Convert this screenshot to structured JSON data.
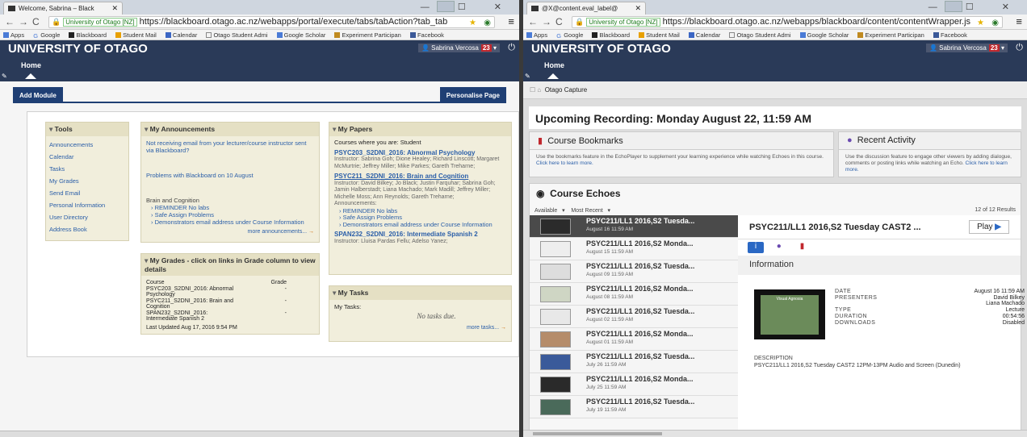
{
  "left": {
    "tab_title": "Welcome, Sabrina – Black",
    "window_controls": "— ☐ ✕",
    "url": {
      "site": "University of Otago [NZ]",
      "text": "https://blackboard.otago.ac.nz/webapps/portal/execute/tabs/tabAction?tab_tab"
    },
    "bookmarks": [
      "Apps",
      "Google",
      "Blackboard",
      "Student Mail",
      "Calendar",
      "Otago Student Admi",
      "Google Scholar",
      "Experiment Participan",
      "Facebook"
    ],
    "brand": "UNIVERSITY OF OTAGO",
    "user": "Sabrina Vercosa",
    "badge": "23",
    "home_tab": "Home",
    "add_module": "Add Module",
    "personalise": "Personalise Page",
    "tools": {
      "title": "Tools",
      "items": [
        "Announcements",
        "Calendar",
        "Tasks",
        "My Grades",
        "Send Email",
        "Personal Information",
        "User Directory",
        "Address Book"
      ]
    },
    "announcements": {
      "title": "My Announcements",
      "a1": "Not receiving email from your lecturer/course instructor sent via Blackboard?",
      "a2": "Problems with Blackboard on 10 August",
      "group": "Brain and Cognition",
      "bullets": [
        "REMINDER No labs",
        "Safe Assign Problems",
        "Demonstrators email address under Course Information"
      ],
      "more": "more announcements..."
    },
    "grades": {
      "title": "My Grades - click on links in Grade column to view details",
      "col_course": "Course",
      "col_grade": "Grade",
      "rows": [
        {
          "course": "PSYC203_S2DNI_2016: Abnormal Psychology",
          "grade": "-"
        },
        {
          "course": "PSYC211_S2DNI_2016: Brain and Cognition",
          "grade": "-"
        },
        {
          "course": "SPAN232_S2DNI_2016: Intermediate Spanish 2",
          "grade": "-"
        }
      ],
      "updated": "Last Updated Aug 17, 2016 9:54 PM"
    },
    "papers": {
      "title": "My Papers",
      "intro": "Courses where you are: Student",
      "p1": "PSYC203_S2DNI_2016: Abnormal Psychology",
      "p1_instr": "Instructor: Sabrina Goh; Dione Healey; Richard Linscott; Margaret McMurtrie; Jeffrey Miller; Mike Parkes; Gareth Treharne;",
      "p2": "PSYC211_S2DNI_2016: Brain and Cognition",
      "p2_instr": "Instructor: David Bilkey; Jo Black; Justin Farquhar; Sabrina Goh; Jamin Halberstadt; Liana Machado; Mark Madill; Jeffrey Miller; Michelle Moss; Ann Reynolds; Gareth Treharne;",
      "ann_label": "Announcements:",
      "ann": [
        "REMINDER No labs",
        "Safe Assign Problems",
        "Demonstrators email address under Course Information"
      ],
      "p3": "SPAN232_S2DNI_2016: Intermediate Spanish 2",
      "p3_instr": "Instructor: Lluisa Pardas Fellu; Adelso Yanez;"
    },
    "tasks": {
      "title": "My Tasks",
      "label": "My Tasks:",
      "empty": "No tasks due.",
      "more": "more tasks..."
    }
  },
  "right": {
    "tab_title": "@X@content.eval_label@",
    "window_controls": "— ☐ ✕",
    "url": {
      "site": "University of Otago [NZ]",
      "text": "https://blackboard.otago.ac.nz/webapps/blackboard/content/contentWrapper.js"
    },
    "bookmarks": [
      "Apps",
      "Google",
      "Blackboard",
      "Student Mail",
      "Calendar",
      "Otago Student Admi",
      "Google Scholar",
      "Experiment Participan",
      "Facebook"
    ],
    "brand": "UNIVERSITY OF OTAGO",
    "user": "Sabrina Vercosa",
    "badge": "23",
    "home_tab": "Home",
    "crumb": "Otago Capture",
    "upcoming": "Upcoming Recording: Monday August 22, 11:59 AM",
    "bookmarks_card": {
      "title": "Course Bookmarks",
      "text": "Use the bookmarks feature in the EchoPlayer to supplement your learning experience while watching Echoes in this course.",
      "link": "Click here to learn more."
    },
    "activity_card": {
      "title": "Recent Activity",
      "text": "Use the discussion feature to engage other viewers by adding dialogue, comments or posting links while watching an Echo.",
      "link": "Click here to learn more."
    },
    "echoes": {
      "title": "Course Echoes",
      "filter1": "Available",
      "filter2": "Most Recent",
      "results": "12 of 12 Results",
      "items": [
        {
          "title": "PSYC211/LL1 2016,S2 Tuesda...",
          "date": "August 16 11:59 AM"
        },
        {
          "title": "PSYC211/LL1 2016,S2 Monda...",
          "date": "August 15 11:59 AM"
        },
        {
          "title": "PSYC211/LL1 2016,S2 Tuesda...",
          "date": "August 09 11:59 AM"
        },
        {
          "title": "PSYC211/LL1 2016,S2 Monda...",
          "date": "August 08 11:59 AM"
        },
        {
          "title": "PSYC211/LL1 2016,S2 Tuesda...",
          "date": "August 02 11:59 AM"
        },
        {
          "title": "PSYC211/LL1 2016,S2 Monda...",
          "date": "August 01 11:59 AM"
        },
        {
          "title": "PSYC211/LL1 2016,S2 Tuesda...",
          "date": "July 26 11:59 AM"
        },
        {
          "title": "PSYC211/LL1 2016,S2 Monda...",
          "date": "July 25 11:59 AM"
        },
        {
          "title": "PSYC211/LL1 2016,S2 Tuesda...",
          "date": "July 19 11:59 AM"
        }
      ]
    },
    "detail": {
      "title": "PSYC211/LL1 2016,S2 Tuesday CAST2 ...",
      "play": "Play",
      "info": "Information",
      "video_caption": "Visual Agnosia",
      "date_label": "DATE",
      "date": "August 16 11:59 AM",
      "presenters_label": "PRESENTERS",
      "presenters": [
        "David Bilkey",
        "Liana Machado"
      ],
      "type_label": "TYPE",
      "type": "Lecture",
      "duration_label": "DURATION",
      "duration": "00:54:56",
      "downloads_label": "DOWNLOADS",
      "downloads": "Disabled",
      "desc_label": "DESCRIPTION",
      "desc": "PSYC211/LL1 2016,S2 Tuesday CAST2 12PM-13PM Audio and Screen (Dunedin)"
    }
  }
}
